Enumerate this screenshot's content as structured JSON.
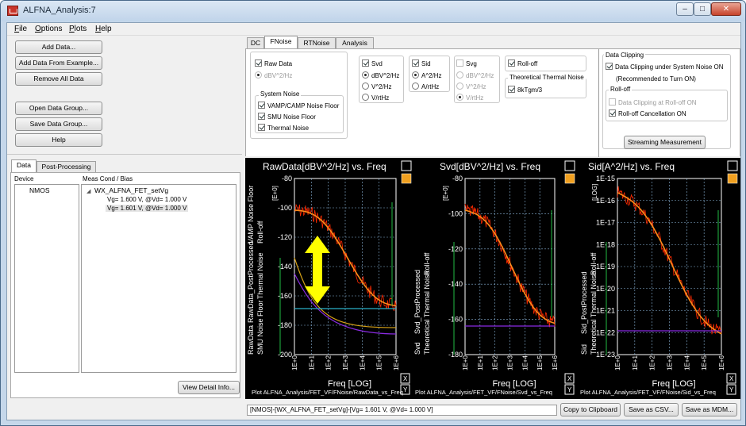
{
  "window": {
    "title": "ALFNA_Analysis:7",
    "controls": [
      "minimize",
      "maximize",
      "close"
    ]
  },
  "menu": [
    "File",
    "Options",
    "Plots",
    "Help"
  ],
  "left_buttons": {
    "add_data": "Add Data...",
    "add_data_example": "Add Data From Example...",
    "remove_all": "Remove All Data",
    "open_group": "Open Data Group...",
    "save_group": "Save Data Group...",
    "help": "Help"
  },
  "left_tabs": [
    "Data",
    "Post-Processing"
  ],
  "data_table": {
    "col_device": "Device",
    "col_meas": "Meas Cond / Bias",
    "device": "NMOS",
    "tree_root": "WX_ALFNA_FET_setVg",
    "children": [
      "Vg= 1.600 V, @Vd= 1.000 V",
      "Vg= 1.601 V, @Vd= 1.000 V"
    ]
  },
  "view_detail": "View Detail Info...",
  "main_tabs": [
    "DC",
    "FNoise",
    "RTNoise",
    "Analysis"
  ],
  "options": {
    "raw_data": "Raw Data",
    "raw_unit": "dBV^2/Hz",
    "system_noise_title": "System Noise",
    "vamp": "VAMP/CAMP Noise Floor",
    "smu": "SMU Noise Floor",
    "thermal": "Thermal Noise",
    "svd": "Svd",
    "svd_units": [
      "dBV^2/Hz",
      "V^2/Hz",
      "V/rtHz"
    ],
    "sid": "Sid",
    "sid_units": [
      "A^2/Hz",
      "A/rtHz"
    ],
    "svg": "Svg",
    "svg_units": [
      "dBV^2/Hz",
      "V^2/Hz",
      "V/rtHz"
    ],
    "rolloff": "Roll-off",
    "thermal_title": "Theoretical Thermal Noise",
    "kt": "8kTgm/3",
    "clipping_title": "Data Clipping",
    "clip_sys": "Data Clipping under System Noise ON",
    "clip_rec": "(Recommended to Turn ON)",
    "rolloff_title": "Roll-off",
    "clip_roll": "Data Clipping at Roll-off ON",
    "roll_cancel": "Roll-off Cancellation ON",
    "streaming": "Streaming Measurement"
  },
  "plots": [
    {
      "title": "RawData[dBV^2/Hz] vs. Freq",
      "y_ticks": [
        "-80",
        "-100",
        "-120",
        "-140",
        "-160",
        "-180",
        "-200"
      ],
      "y_scale": "[E+0]",
      "side_labels": [
        "RawData",
        "RawData_PostProcessed",
        "VAMP Noise Floor",
        "SMU Noise Floor",
        "Thermal Noise",
        "Roll-off"
      ],
      "xlabel": "Freq  [LOG]",
      "path": "Plot ALFNA_Analysis/FET_VF/FNoise/RawData_vs_Freq"
    },
    {
      "title": "Svd[dBV^2/Hz] vs. Freq",
      "y_ticks": [
        "-80",
        "-100",
        "-120",
        "-140",
        "-160",
        "-180"
      ],
      "y_scale": "[E+0]",
      "side_labels": [
        "Svd",
        "Svd_PostProcessed",
        "Roll-off",
        "Theoretical Thermal Noise"
      ],
      "xlabel": "Freq  [LOG]",
      "path": "Plot ALFNA_Analysis/FET_VF/FNoise/Svd_vs_Freq"
    },
    {
      "title": "Sid[A^2/Hz] vs. Freq",
      "y_ticks": [
        "1E-15",
        "1E-16",
        "1E-17",
        "1E-18",
        "1E-19",
        "1E-20",
        "1E-21",
        "1E-22",
        "1E-23"
      ],
      "y_scale": "[LOG]",
      "side_labels": [
        "Sid",
        "Sid_PostProcessed",
        "Roll-off",
        "Theoretical Thermal Noise"
      ],
      "xlabel": "Freq  [LOG]",
      "path": "Plot ALFNA_Analysis/FET_VF/FNoise/Sid_vs_Freq"
    }
  ],
  "x_ticks": [
    "1E+0",
    "1E+1",
    "1E+2",
    "1E+3",
    "1E+4",
    "1E+5",
    "1E+6"
  ],
  "plot_buttons": {
    "x": "X",
    "y": "Y"
  },
  "status_text": "[NMOS]-[WX_ALFNA_FET_setVg]-[Vg= 1.601 V, @Vd= 1.000 V]",
  "bottom_buttons": {
    "copy": "Copy to Clipboard",
    "csv": "Save as CSV...",
    "mdm": "Save as MDM..."
  },
  "colors": {
    "data": "#ff2a00",
    "processed": "#ff8c1a",
    "vamp": "#8a2be2",
    "smu": "#d4a017",
    "thermal": "#2ab0c8",
    "rolloff": "#22bb44",
    "annotation": "#ffff00"
  }
}
